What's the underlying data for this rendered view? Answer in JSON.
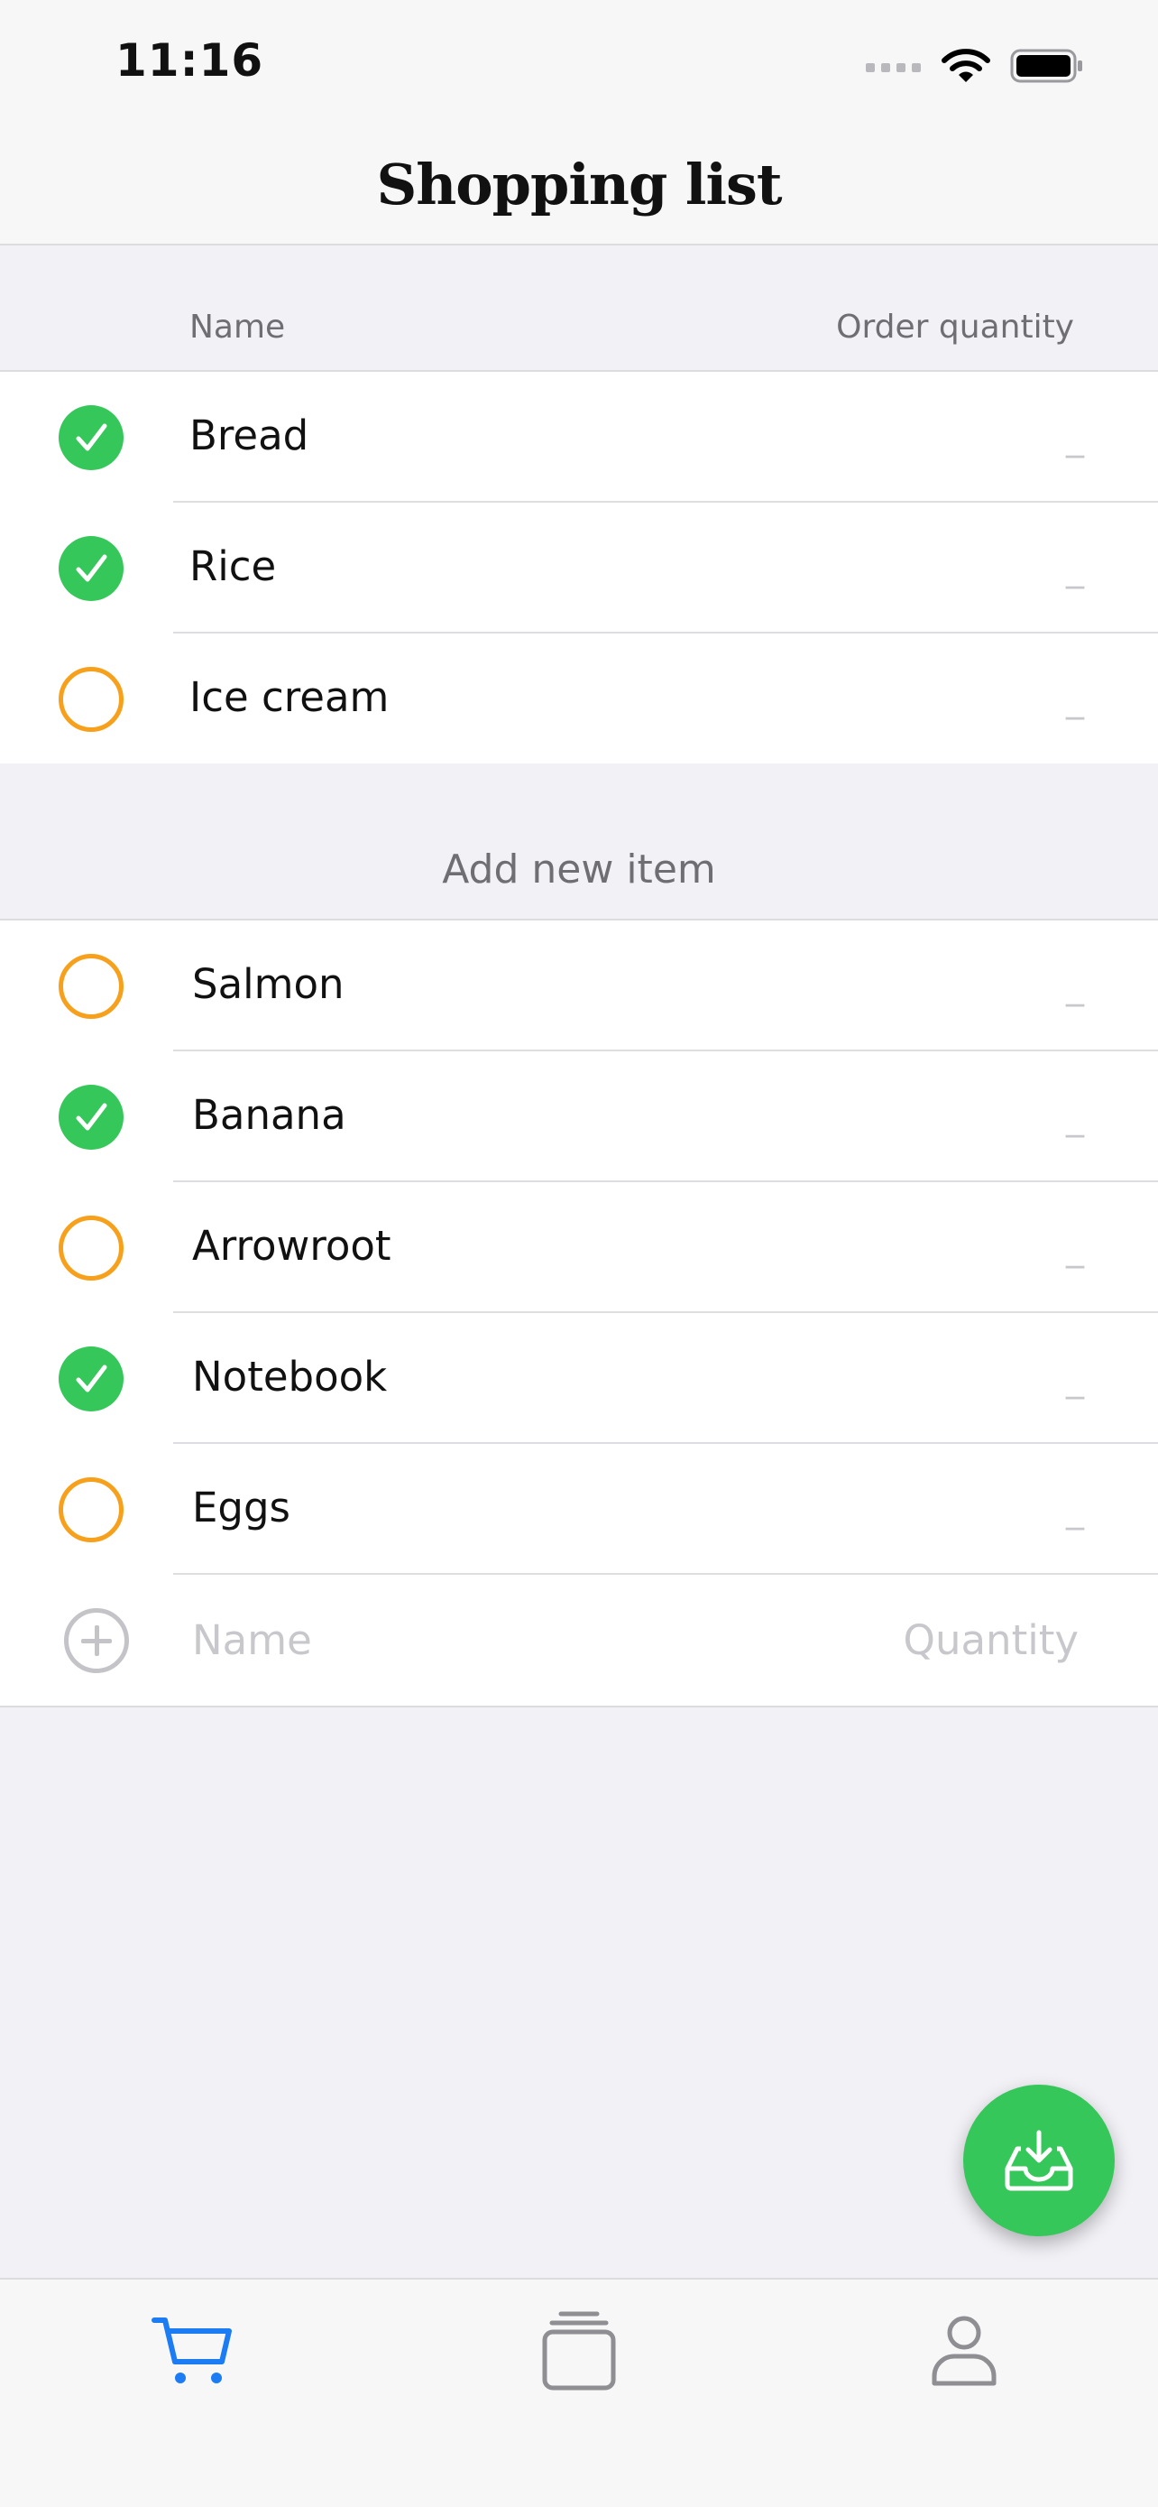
{
  "status_bar": {
    "time": "11:16"
  },
  "nav": {
    "title": "Shopping list"
  },
  "columns": {
    "name": "Name",
    "quantity": "Order quantity"
  },
  "list1": [
    {
      "name": "Bread",
      "quantity": "_",
      "checked": true
    },
    {
      "name": "Rice",
      "quantity": "_",
      "checked": true
    },
    {
      "name": "Ice cream",
      "quantity": "_",
      "checked": false
    }
  ],
  "add_section": {
    "title": "Add new item"
  },
  "list2": [
    {
      "name": "Salmon",
      "quantity": "_",
      "checked": false
    },
    {
      "name": "Banana",
      "quantity": "_",
      "checked": true
    },
    {
      "name": "Arrowroot",
      "quantity": "_",
      "checked": false
    },
    {
      "name": "Notebook",
      "quantity": "_",
      "checked": true
    },
    {
      "name": "Eggs",
      "quantity": "_",
      "checked": false
    }
  ],
  "new_item": {
    "name_placeholder": "Name",
    "quantity_placeholder": "Quantity"
  },
  "colors": {
    "accent_green": "#35c759",
    "accent_orange": "#f7a01c",
    "tab_active": "#1b7cf4"
  },
  "icons": {
    "fab": "inbox-download-icon",
    "tabs": [
      "cart-icon",
      "stack-icon",
      "person-icon"
    ]
  },
  "tabs": {
    "active": "cart"
  }
}
